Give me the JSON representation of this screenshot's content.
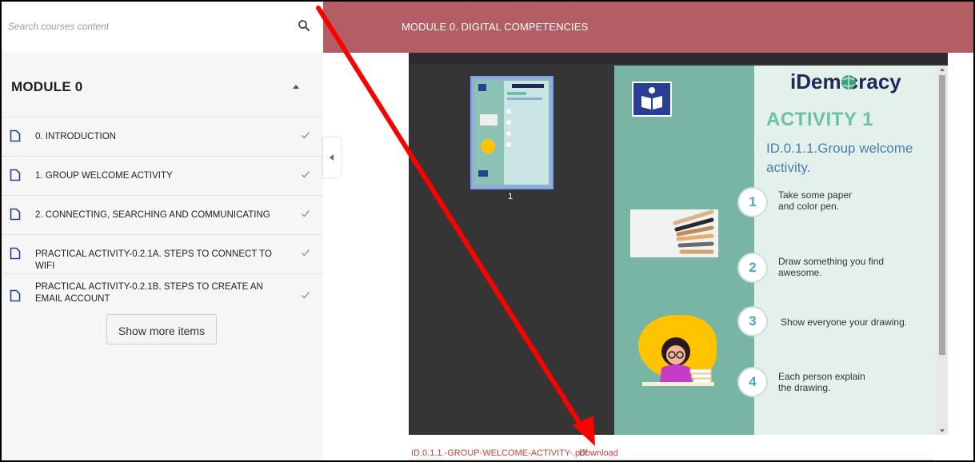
{
  "sidebar": {
    "search_placeholder": "Search courses content",
    "module_title": "MODULE 0",
    "items": [
      {
        "label": "0. INTRODUCTION"
      },
      {
        "label": "1. GROUP WELCOME ACTIVITY"
      },
      {
        "label": "2. CONNECTING, SEARCHING AND COMMUNICATING"
      },
      {
        "label": "PRACTICAL ACTIVITY-0.2.1A. STEPS TO CONNECT TO WIFI"
      },
      {
        "label": "PRACTICAL ACTIVITY-0.2.1B. STEPS TO CREATE AN EMAIL ACCOUNT"
      }
    ],
    "show_more_label": "Show more items"
  },
  "header": {
    "title": "MODULE 0. DIGITAL COMPETENCIES"
  },
  "viewer": {
    "thumbnail_page_number": "1",
    "page": {
      "brand": "iDem cracy",
      "activity_title": "ACTIVITY 1",
      "activity_subtitle": "ID.0.1.1.Group welcome activity.",
      "steps": [
        {
          "number": "1",
          "text": "Take some paper and color pen."
        },
        {
          "number": "2",
          "text": "Draw something you find awesome."
        },
        {
          "number": "3",
          "text": "Show everyone your drawing."
        },
        {
          "number": "4",
          "text": "Each person explain the drawing."
        }
      ]
    }
  },
  "attachment": {
    "filename": "ID.0.1.1.-GROUP-WELCOME-ACTIVITY-.pdf",
    "download_label": "Download"
  },
  "colors": {
    "header_bg": "#b35e64",
    "link": "#c0463e",
    "annotation_arrow": "#ff0000"
  }
}
